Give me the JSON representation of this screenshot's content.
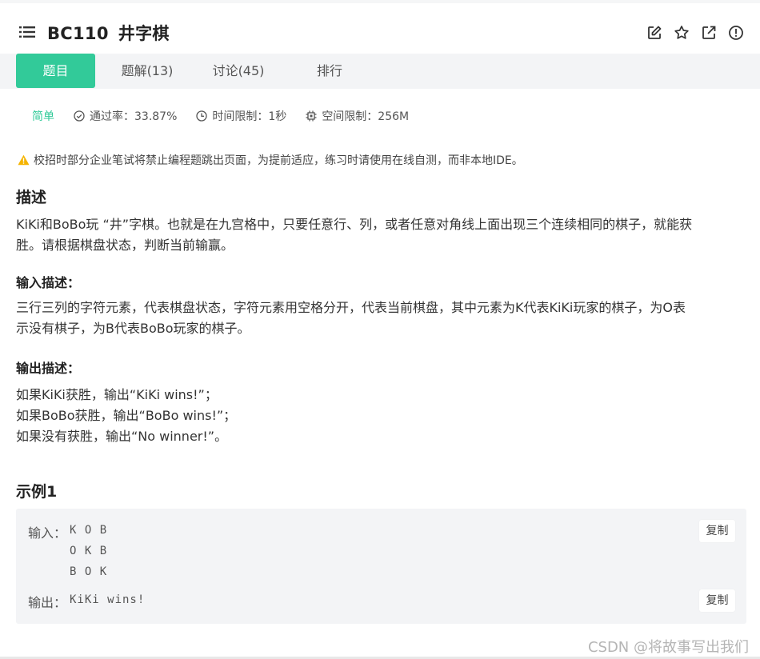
{
  "header": {
    "problem_id": "BC110",
    "problem_title": "井字棋",
    "icons": [
      "menu-icon",
      "edit-icon",
      "star-icon",
      "share-icon",
      "report-icon"
    ]
  },
  "tabs": [
    {
      "label": "题目",
      "active": true
    },
    {
      "label": "题解(13)",
      "active": false
    },
    {
      "label": "讨论(45)",
      "active": false
    },
    {
      "label": "排行",
      "active": false
    }
  ],
  "meta": {
    "difficulty": "简单",
    "pass_rate": "通过率：33.87%",
    "time_limit": "时间限制：1秒",
    "space_limit": "空间限制：256M"
  },
  "notice": "校招时部分企业笔试将禁止编程题跳出页面，为提前适应，练习时请使用在线自测，而非本地IDE。",
  "description": {
    "heading": "描述",
    "text_line1": "KiKi和BoBo玩 “井”字棋。也就是在九宫格中，只要任意行、列，或者任意对角线上面出现三个连续相同的棋子，就能获",
    "text_line2": "胜。请根据棋盘状态，判断当前输赢。"
  },
  "input_desc": {
    "heading": "输入描述：",
    "text_line1": "三行三列的字符元素，代表棋盘状态，字符元素用空格分开，代表当前棋盘，其中元素为K代表KiKi玩家的棋子，为O表",
    "text_line2": "示没有棋子，为B代表BoBo玩家的棋子。"
  },
  "output_desc": {
    "heading": "输出描述：",
    "lines": [
      "如果KiKi获胜，输出“KiKi wins!”；",
      "如果BoBo获胜，输出“BoBo wins!”；",
      "如果没有获胜，输出“No winner!”。"
    ]
  },
  "example": {
    "heading": "示例1",
    "input_label": "输入：",
    "input_lines": [
      "K O B",
      "O K B",
      "B O K"
    ],
    "output_label": "输出：",
    "output_value": "KiKi wins!",
    "copy_label": "复制"
  },
  "watermark": "CSDN @将故事写出我们",
  "colors": {
    "accent": "#32ca99",
    "tab_bg": "#f3f4f6",
    "warning": "#f5b400"
  }
}
